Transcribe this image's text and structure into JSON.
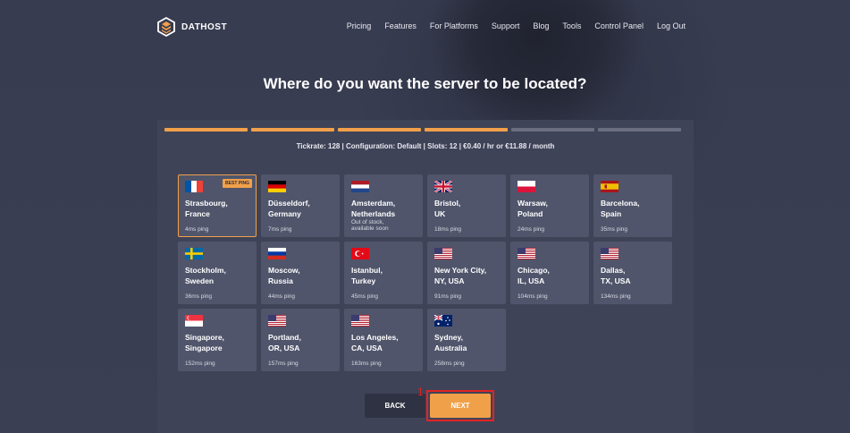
{
  "header": {
    "brand": "DATHOST",
    "nav": [
      "Pricing",
      "Features",
      "For Platforms",
      "Support",
      "Blog",
      "Tools",
      "Control Panel",
      "Log Out"
    ]
  },
  "page": {
    "title": "Where do you want the server to be located?",
    "summary": "Tickrate: 128 | Configuration: Default | Slots: 12 | €0.40 / hr or €11.88 / month"
  },
  "progress": {
    "steps_total": 6,
    "steps_completed": 4,
    "active_color": "#f1a04a",
    "inactive_color": "#6a6e80"
  },
  "locations": [
    {
      "city": "Strasbourg,",
      "country": "France",
      "note": "",
      "ping": "4ms ping",
      "flag": "flag-france-icon",
      "badge": "BEST PING",
      "selected": true
    },
    {
      "city": "Düsseldorf,",
      "country": "Germany",
      "note": "",
      "ping": "7ms ping",
      "flag": "flag-germany-icon",
      "badge": "",
      "selected": false
    },
    {
      "city": "Amsterdam,",
      "country": "Netherlands",
      "note": "Out of stock, available soon",
      "ping": "",
      "flag": "flag-netherlands-icon",
      "badge": "",
      "selected": false
    },
    {
      "city": "Bristol,",
      "country": "UK",
      "note": "",
      "ping": "18ms ping",
      "flag": "flag-uk-icon",
      "badge": "",
      "selected": false
    },
    {
      "city": "Warsaw,",
      "country": "Poland",
      "note": "",
      "ping": "24ms ping",
      "flag": "flag-poland-icon",
      "badge": "",
      "selected": false
    },
    {
      "city": "Barcelona,",
      "country": "Spain",
      "note": "",
      "ping": "35ms ping",
      "flag": "flag-spain-icon",
      "badge": "",
      "selected": false
    },
    {
      "city": "Stockholm,",
      "country": "Sweden",
      "note": "",
      "ping": "36ms ping",
      "flag": "flag-sweden-icon",
      "badge": "",
      "selected": false
    },
    {
      "city": "Moscow,",
      "country": "Russia",
      "note": "",
      "ping": "44ms ping",
      "flag": "flag-russia-icon",
      "badge": "",
      "selected": false
    },
    {
      "city": "Istanbul,",
      "country": "Turkey",
      "note": "",
      "ping": "45ms ping",
      "flag": "flag-turkey-icon",
      "badge": "",
      "selected": false
    },
    {
      "city": "New York City,",
      "country": "NY, USA",
      "note": "",
      "ping": "91ms ping",
      "flag": "flag-usa-icon",
      "badge": "",
      "selected": false
    },
    {
      "city": "Chicago,",
      "country": "IL, USA",
      "note": "",
      "ping": "104ms ping",
      "flag": "flag-usa-icon",
      "badge": "",
      "selected": false
    },
    {
      "city": "Dallas,",
      "country": "TX, USA",
      "note": "",
      "ping": "134ms ping",
      "flag": "flag-usa-icon",
      "badge": "",
      "selected": false
    },
    {
      "city": "Singapore,",
      "country": "Singapore",
      "note": "",
      "ping": "152ms ping",
      "flag": "flag-singapore-icon",
      "badge": "",
      "selected": false
    },
    {
      "city": "Portland,",
      "country": "OR, USA",
      "note": "",
      "ping": "157ms ping",
      "flag": "flag-usa-icon",
      "badge": "",
      "selected": false
    },
    {
      "city": "Los Angeles,",
      "country": "CA, USA",
      "note": "",
      "ping": "163ms ping",
      "flag": "flag-usa-icon",
      "badge": "",
      "selected": false
    },
    {
      "city": "Sydney,",
      "country": "Australia",
      "note": "",
      "ping": "258ms ping",
      "flag": "flag-australia-icon",
      "badge": "",
      "selected": false
    }
  ],
  "actions": {
    "back": "BACK",
    "next": "NEXT",
    "marker": "1"
  },
  "colors": {
    "accent": "#f1a04a",
    "background": "#3a3e52",
    "panel": "#3f4357",
    "card": "#50556b",
    "highlight": "#e02424"
  }
}
